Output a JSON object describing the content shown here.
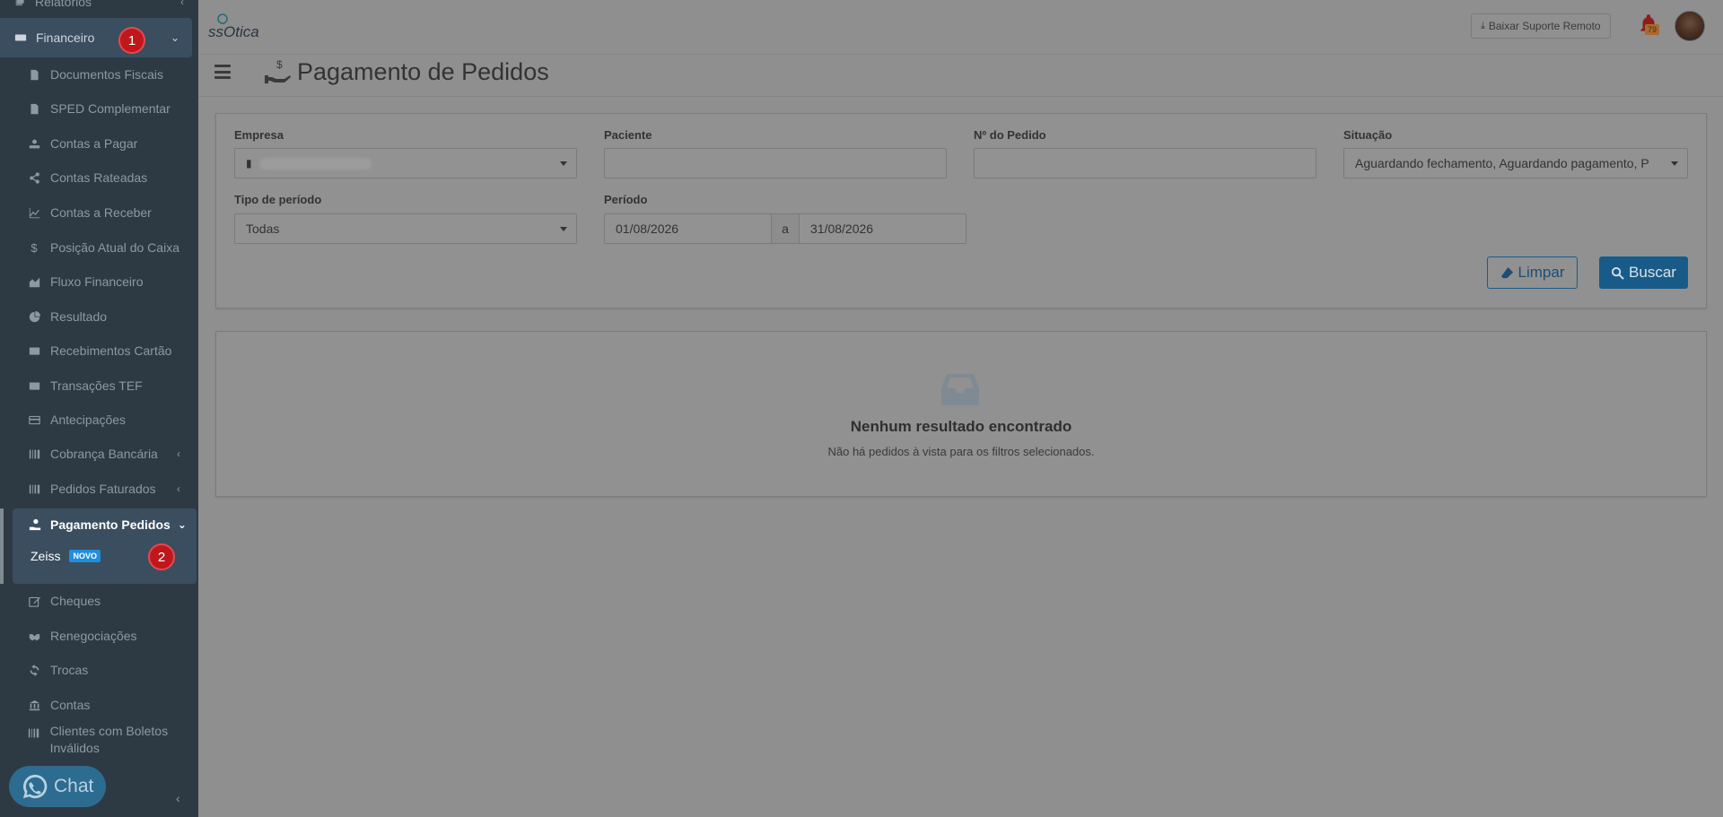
{
  "sidebar": {
    "top_item": "Relatórios",
    "financeiro": "Financeiro",
    "step1": "1",
    "items": [
      {
        "label": "Documentos Fiscais",
        "icon": "file-icon"
      },
      {
        "label": "SPED Complementar",
        "icon": "file-text-icon"
      },
      {
        "label": "Contas a Pagar",
        "icon": "hand-coin-icon"
      },
      {
        "label": "Contas Rateadas",
        "icon": "share-icon"
      },
      {
        "label": "Contas a Receber",
        "icon": "line-chart-icon"
      },
      {
        "label": "Posição Atual do Caixa",
        "icon": "dollar-icon"
      },
      {
        "label": "Fluxo Financeiro",
        "icon": "area-chart-icon"
      },
      {
        "label": "Resultado",
        "icon": "pie-chart-icon"
      },
      {
        "label": "Recebimentos Cartão",
        "icon": "credit-card-icon"
      },
      {
        "label": "Transações TEF",
        "icon": "card-icon"
      },
      {
        "label": "Antecipações",
        "icon": "card-alt-icon"
      },
      {
        "label": "Cobrança Bancária",
        "icon": "barcode-icon"
      },
      {
        "label": "Pedidos Faturados",
        "icon": "barcode-icon"
      }
    ],
    "pagamento": "Pagamento Pedidos",
    "zeiss": "Zeiss",
    "novo": "NOVO",
    "step2": "2",
    "items_after": [
      {
        "label": "Cheques",
        "icon": "edit-icon"
      },
      {
        "label": "Renegociações",
        "icon": "handshake-icon"
      },
      {
        "label": "Trocas",
        "icon": "refresh-icon"
      },
      {
        "label": "Contas",
        "icon": "bank-icon"
      },
      {
        "label": "Clientes com Boletos Inválidos",
        "icon": "barcode-icon"
      }
    ],
    "chat": "Chat"
  },
  "header": {
    "logo": "ssOtica",
    "suporte_btn": "Baixar Suporte Remoto",
    "notifications": "79"
  },
  "page": {
    "title": "Pagamento de Pedidos"
  },
  "filters": {
    "empresa_label": "Empresa",
    "paciente_label": "Paciente",
    "pedido_label": "Nº do Pedido",
    "situacao_label": "Situação",
    "situacao_value": "Aguardando fechamento, Aguardando pagamento, P",
    "tipo_label": "Tipo de período",
    "tipo_value": "Todas",
    "periodo_label": "Período",
    "periodo_start": "01/08/2026",
    "periodo_sep": "a",
    "periodo_end": "31/08/2026",
    "limpar": "Limpar",
    "buscar": "Buscar"
  },
  "results": {
    "empty_title": "Nenhum resultado encontrado",
    "empty_sub": "Não há pedidos à vista para os filtros selecionados."
  }
}
